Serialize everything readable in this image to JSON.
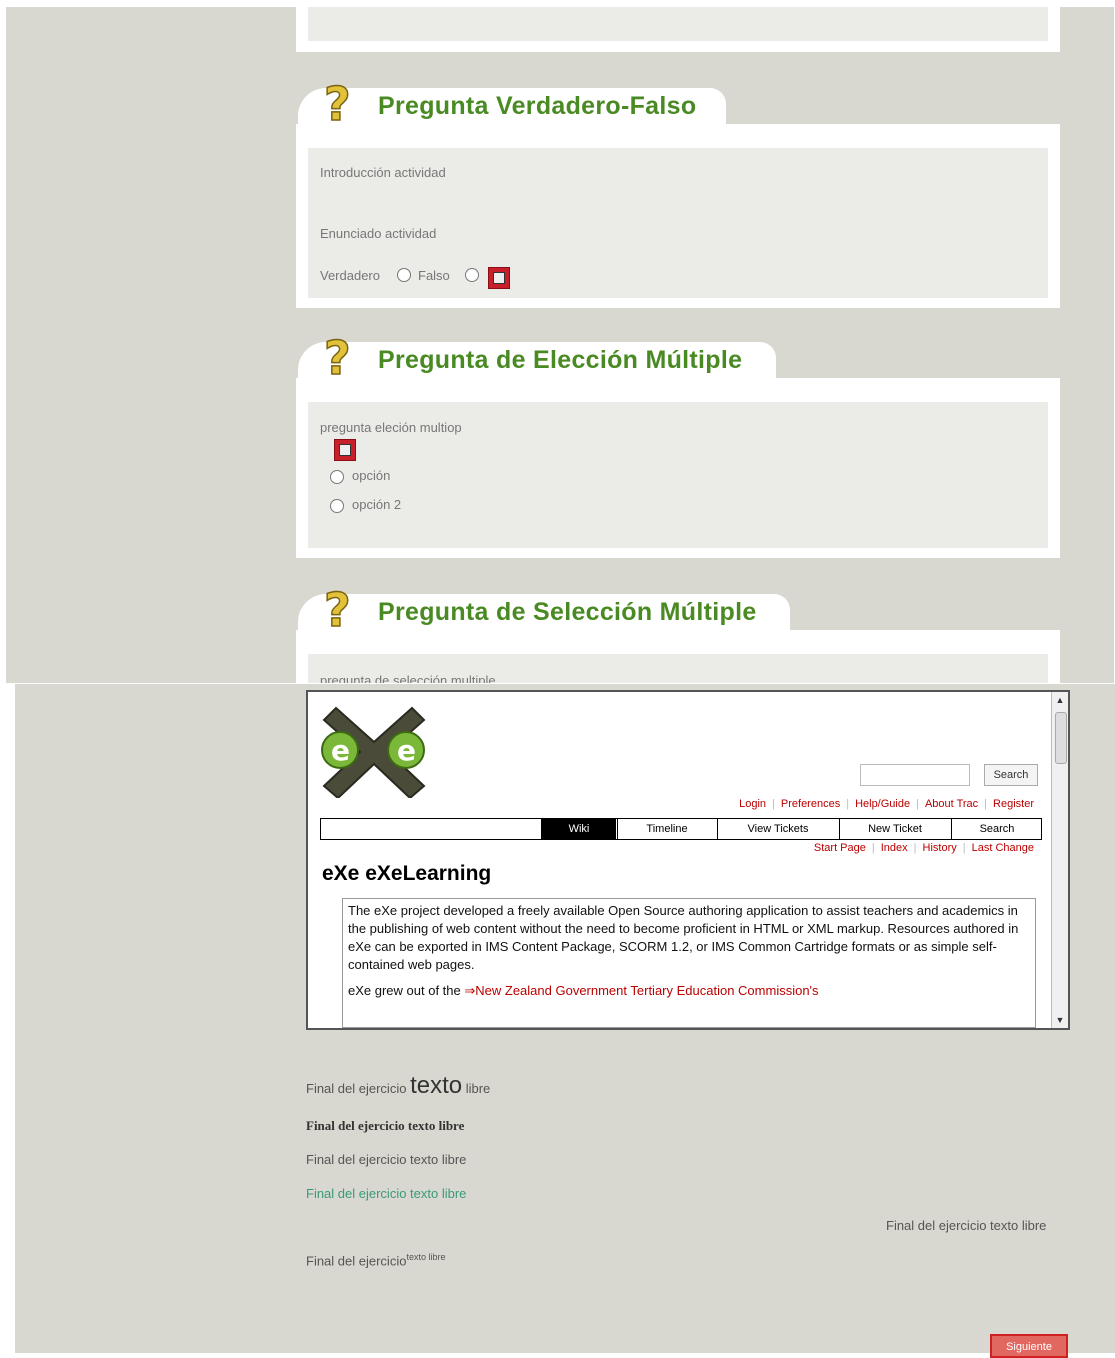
{
  "questions": [
    {
      "title": "Pregunta Verdadero-Falso",
      "intro": "Introducción actividad",
      "statement": "Enunciado actividad",
      "option_true": "Verdadero",
      "option_false": "Falso"
    },
    {
      "title": "Pregunta de Elección Múltiple",
      "question": "pregunta eleción multiop",
      "options": [
        "opción",
        "opción 2"
      ]
    },
    {
      "title": "Pregunta de Selección Múltiple",
      "question": "pregunta de selección multiple"
    }
  ],
  "embedded_site": {
    "search_button": "Search",
    "meta_nav": [
      "Login",
      "Preferences",
      "Help/Guide",
      "About Trac",
      "Register"
    ],
    "main_nav": [
      "Wiki",
      "Timeline",
      "View Tickets",
      "New Ticket",
      "Search"
    ],
    "ctxt_nav": [
      "Start Page",
      "Index",
      "History",
      "Last Change"
    ],
    "page_title": "eXe eXeLearning",
    "paragraph": "The eXe project developed a freely available Open Source authoring application to assist teachers and academics in the publishing of web content without the need to become proficient in HTML or XML markup. Resources authored in eXe can be exported in IMS Content Package, SCORM 1.2, or IMS Common Cartridge formats or as simple self-contained web pages.",
    "paragraph2_prefix": "eXe grew out of the ",
    "paragraph2_link": "New Zealand Government Tertiary Education Commission's"
  },
  "free_text": {
    "line1_a": "Final del ejercicio",
    "line1_big": "texto",
    "line1_c": "libre",
    "line2": "Final del ejercicio texto libre",
    "line3": "Final del ejercicio texto libre",
    "line4": "Final del ejercicio texto libre",
    "line5": "Final del ejercicio texto libre",
    "line6_a": "Final del ejercicio",
    "line6_sup": "texto libre"
  },
  "next_button": "Siguiente",
  "colors": {
    "title_green": "#4a8a23",
    "panel_bg": "#d8d8d0",
    "inner_bg": "#ebebe7",
    "link_red": "#bb0000"
  }
}
